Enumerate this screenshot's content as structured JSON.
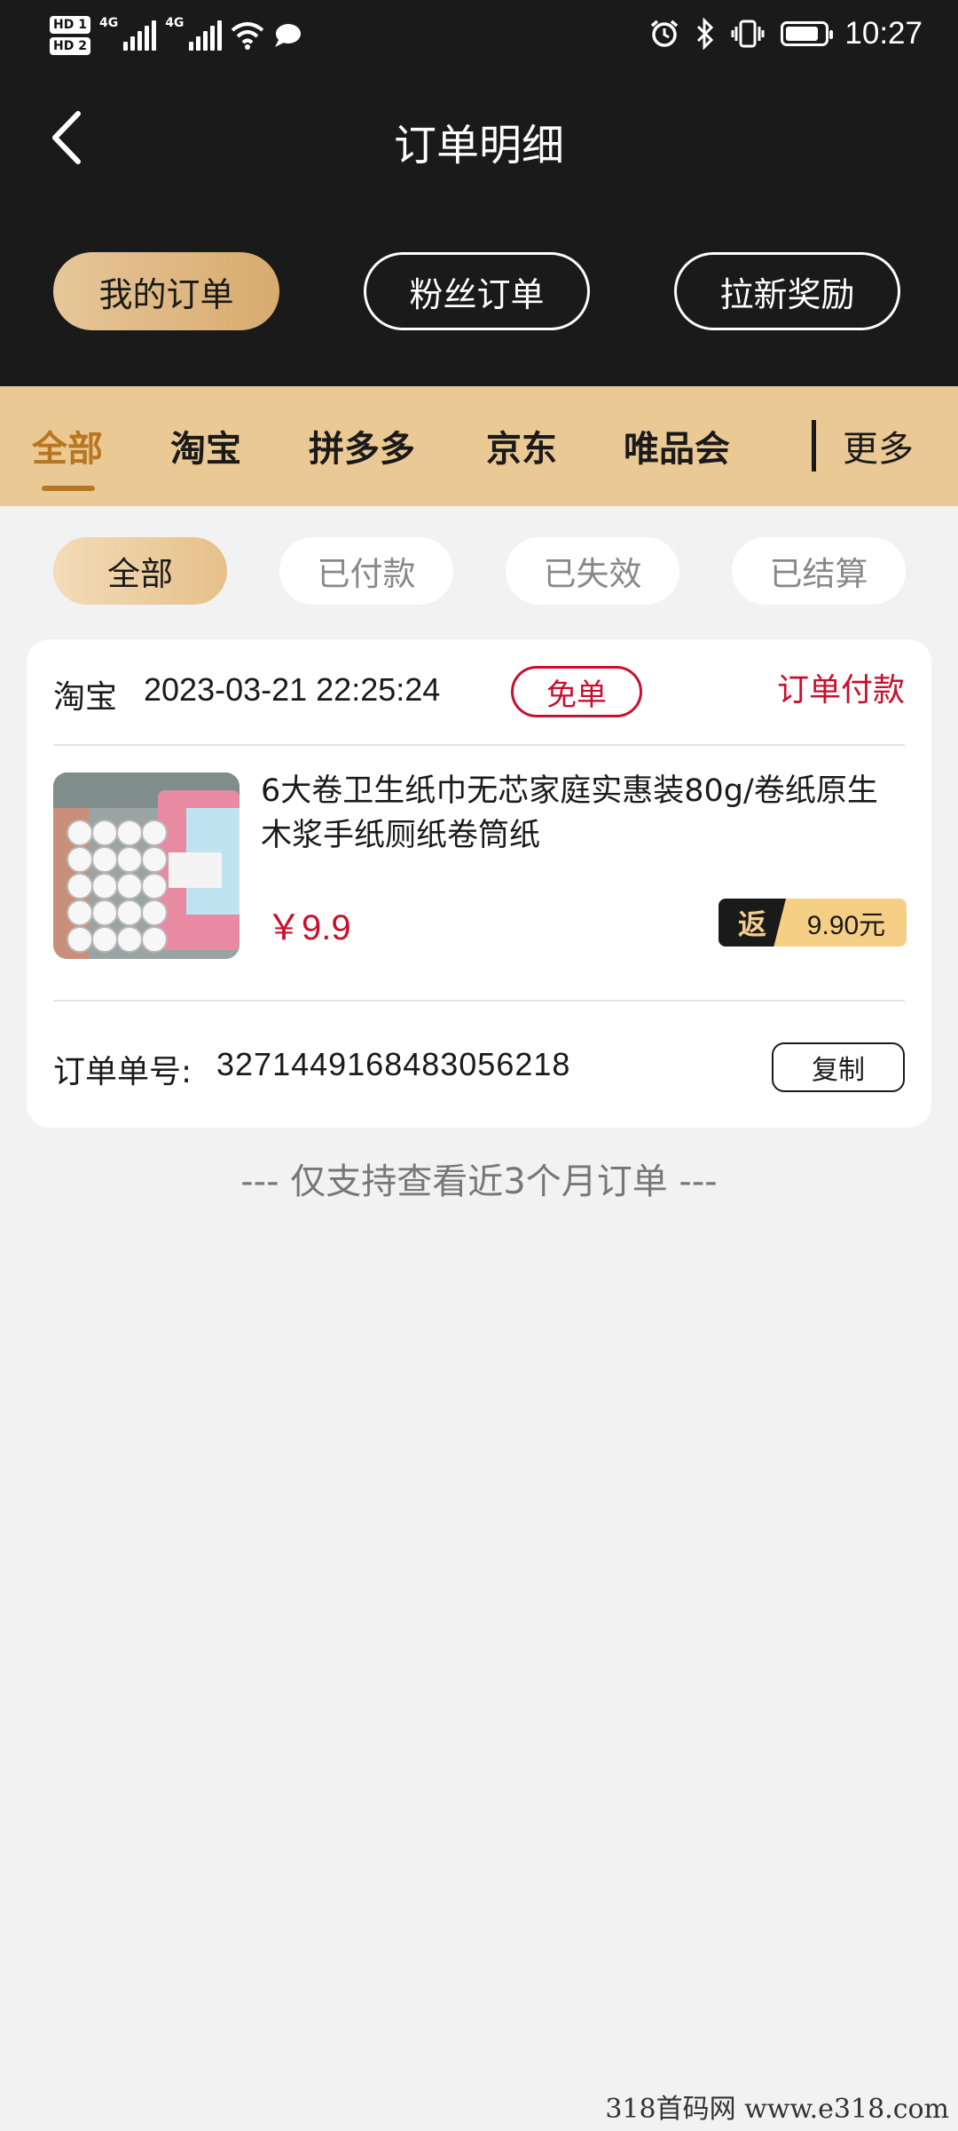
{
  "status_bar": {
    "sim1": "HD 1",
    "sim2": "HD 2",
    "network1": "4G",
    "network2": "4G",
    "time": "10:27",
    "icons": [
      "hd-icon",
      "signal-icon",
      "wifi-icon",
      "chat-bubble-icon",
      "alarm-icon",
      "bluetooth-icon",
      "vibrate-icon",
      "battery-icon"
    ]
  },
  "header": {
    "title": "订单明细",
    "back_icon": "chevron-left-icon"
  },
  "segments": [
    {
      "label": "我的订单",
      "active": true
    },
    {
      "label": "粉丝订单",
      "active": false
    },
    {
      "label": "拉新奖励",
      "active": false
    }
  ],
  "platform_tabs": {
    "items": [
      "全部",
      "淘宝",
      "拼多多",
      "京东",
      "唯品会"
    ],
    "active_index": 0,
    "more_label": "更多"
  },
  "status_filters": {
    "items": [
      "全部",
      "已付款",
      "已失效",
      "已结算"
    ],
    "active_index": 0
  },
  "order": {
    "platform": "淘宝",
    "time": "2023-03-21 22:25:24",
    "badge": "免单",
    "status": "订单付款",
    "product_name": "6大卷卫生纸巾无芯家庭实惠装80g/卷纸原生木浆手纸厕纸卷筒纸",
    "price": "￥9.9",
    "rebate_label": "返",
    "rebate_amount": "9.90元",
    "order_no_label": "订单单号:",
    "order_no": "3271449168483056218",
    "copy_label": "复制"
  },
  "footer_note": "--- 仅支持查看近3个月订单 ---",
  "watermark": "318首码网  www.e318.com",
  "colors": {
    "dark_bg": "#1a1a1a",
    "gold_tab_bar": "#ebc995",
    "accent_gold": "#b87620",
    "red": "#c8102e",
    "page_bg": "#f2f2f2"
  }
}
